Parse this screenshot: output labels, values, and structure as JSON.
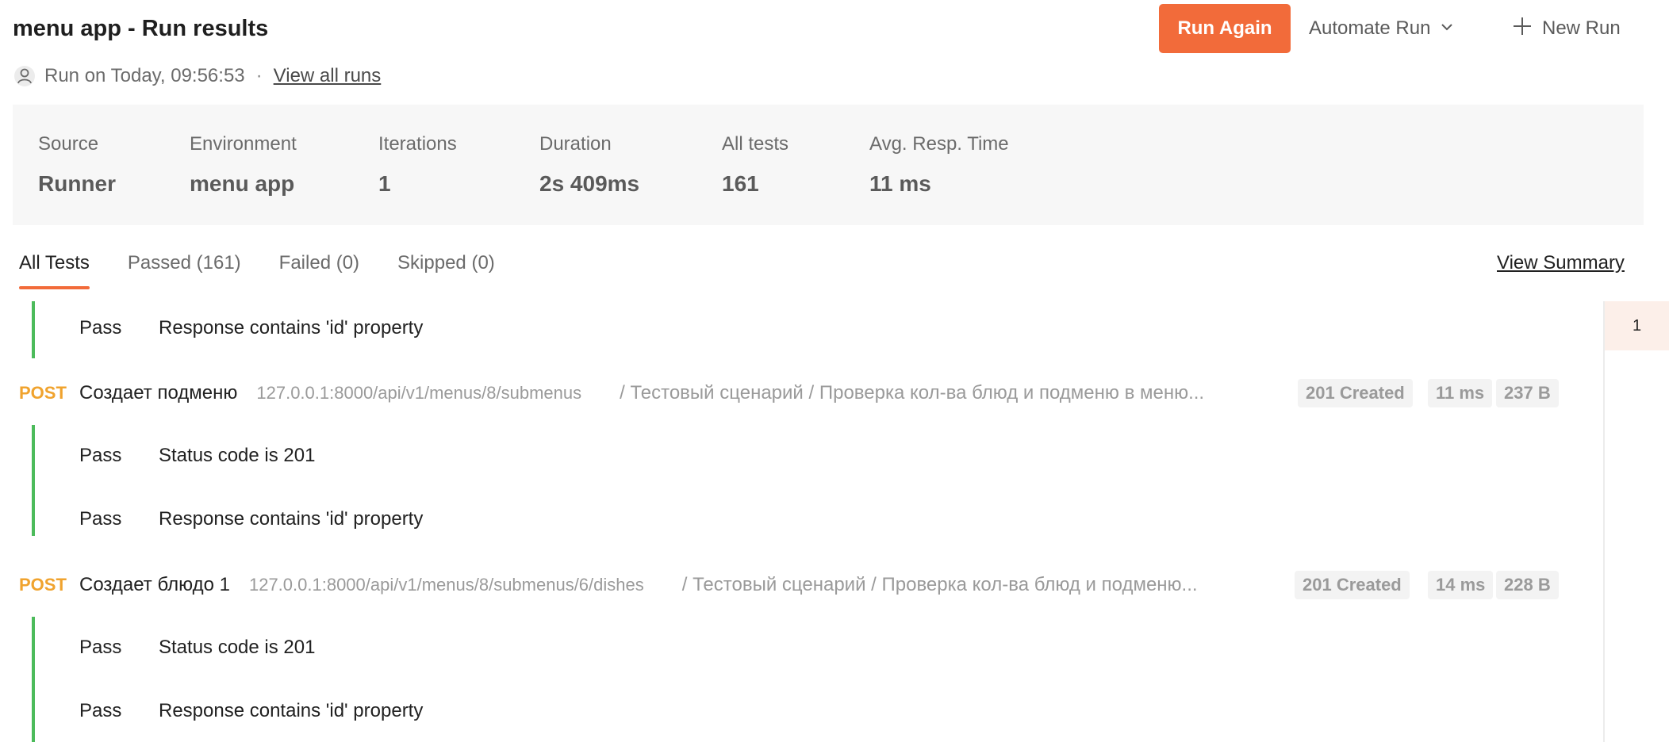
{
  "header": {
    "title": "menu app - Run results",
    "run_on": "Run on Today, 09:56:53",
    "separator": "·",
    "view_all_runs": "View all runs",
    "run_again_label": "Run Again",
    "automate_run_label": "Automate Run",
    "new_run_label": "New Run"
  },
  "summary": {
    "source": {
      "label": "Source",
      "value": "Runner"
    },
    "environment": {
      "label": "Environment",
      "value": "menu app"
    },
    "iterations": {
      "label": "Iterations",
      "value": "1"
    },
    "duration": {
      "label": "Duration",
      "value": "2s 409ms"
    },
    "all_tests": {
      "label": "All tests",
      "value": "161"
    },
    "avg_resp_time": {
      "label": "Avg. Resp. Time",
      "value": "11 ms"
    }
  },
  "tabs": [
    {
      "label": "All Tests",
      "active": true
    },
    {
      "label": "Passed (161)",
      "active": false
    },
    {
      "label": "Failed (0)",
      "active": false
    },
    {
      "label": "Skipped (0)",
      "active": false
    }
  ],
  "view_summary": "View Summary",
  "results": {
    "top_test": {
      "status": "Pass",
      "name": "Response contains 'id' property"
    },
    "requests": [
      {
        "method": "POST",
        "name": "Создает подменю",
        "url": "127.0.0.1:8000/api/v1/menus/8/submenus",
        "path": "/ Тестовый сценарий / Проверка кол-ва блюд и подменю в меню...",
        "status": "201 Created",
        "time": "11 ms",
        "size": "237 B",
        "tests": [
          {
            "status": "Pass",
            "name": "Status code is 201"
          },
          {
            "status": "Pass",
            "name": "Response contains 'id' property"
          }
        ]
      },
      {
        "method": "POST",
        "name": "Создает блюдо 1",
        "url": "127.0.0.1:8000/api/v1/menus/8/submenus/6/dishes",
        "path": "/ Тестовый сценарий / Проверка кол-ва блюд и подменю...",
        "status": "201 Created",
        "time": "14 ms",
        "size": "228 B",
        "tests": [
          {
            "status": "Pass",
            "name": "Status code is 201"
          },
          {
            "status": "Pass",
            "name": "Response contains 'id' property"
          }
        ]
      }
    ]
  },
  "rail": {
    "iteration": "1"
  },
  "colors": {
    "accent": "#f26b3a",
    "pass": "#4cbb5b",
    "method_post": "#f0a32e"
  },
  "icons": {
    "user": "user-icon",
    "chevron": "chevron-down-icon",
    "plus": "plus-icon"
  }
}
